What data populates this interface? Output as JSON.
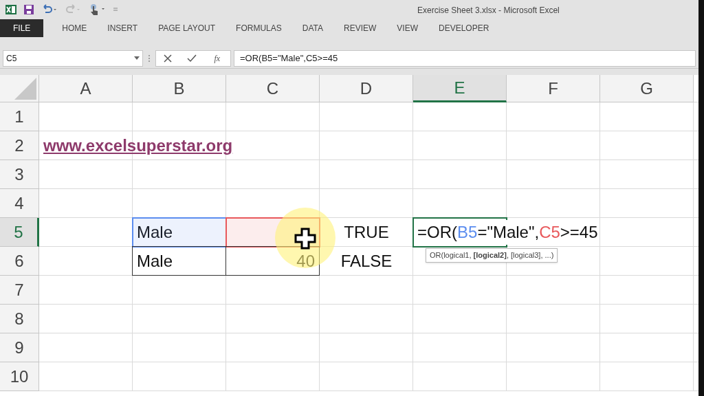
{
  "window": {
    "title": "Exercise Sheet 3.xlsx - Microsoft Excel"
  },
  "ribbon_tabs": [
    {
      "label": "FILE",
      "selected": true
    },
    {
      "label": "HOME",
      "selected": false
    },
    {
      "label": "INSERT",
      "selected": false
    },
    {
      "label": "PAGE LAYOUT",
      "selected": false
    },
    {
      "label": "FORMULAS",
      "selected": false
    },
    {
      "label": "DATA",
      "selected": false
    },
    {
      "label": "REVIEW",
      "selected": false
    },
    {
      "label": "VIEW",
      "selected": false
    },
    {
      "label": "DEVELOPER",
      "selected": false
    }
  ],
  "formula_bar": {
    "name_box": "C5",
    "function_button": "fx",
    "formula": "=OR(B5=\"Male\",C5>=45"
  },
  "columns": [
    {
      "label": "A",
      "selected": false
    },
    {
      "label": "B",
      "selected": false
    },
    {
      "label": "C",
      "selected": false
    },
    {
      "label": "D",
      "selected": false
    },
    {
      "label": "E",
      "selected": true
    },
    {
      "label": "F",
      "selected": false
    },
    {
      "label": "G",
      "selected": false
    }
  ],
  "rows": [
    {
      "header": "1",
      "selected": false,
      "cells": [
        null,
        null,
        null,
        null,
        null,
        null,
        null
      ]
    },
    {
      "header": "2",
      "selected": false,
      "cells": [
        {
          "kind": "link",
          "text": "www.excelsuperstar.org"
        },
        null,
        null,
        null,
        null,
        null,
        null
      ]
    },
    {
      "header": "3",
      "selected": false,
      "cells": [
        null,
        null,
        null,
        null,
        null,
        null,
        null
      ]
    },
    {
      "header": "4",
      "selected": false,
      "cells": [
        null,
        null,
        null,
        null,
        null,
        null,
        null
      ]
    },
    {
      "header": "5",
      "selected": true,
      "cells": [
        null,
        {
          "kind": "text",
          "text": "Male",
          "color": "#5b8def"
        },
        {
          "kind": "empty",
          "color": "#e8585b"
        },
        {
          "kind": "bool",
          "text": "TRUE"
        },
        {
          "kind": "formula",
          "selected": true,
          "parts": [
            {
              "text": "=OR("
            },
            {
              "text": "B5",
              "color": "#5b8def"
            },
            {
              "text": "=\"Male\","
            },
            {
              "text": "C5",
              "color": "#e8585b"
            },
            {
              "text": ">=45"
            }
          ],
          "tooltip": "OR(logical1, **[logical2]**, [logical3], ...)"
        },
        null,
        null
      ]
    },
    {
      "header": "6",
      "selected": false,
      "cells": [
        null,
        {
          "kind": "text",
          "text": "Male",
          "bordered": true
        },
        {
          "kind": "number",
          "text": "40",
          "bordered": true
        },
        {
          "kind": "bool",
          "text": "FALSE"
        },
        null,
        null,
        null
      ]
    },
    {
      "header": "7",
      "selected": false,
      "cells": [
        null,
        null,
        null,
        null,
        null,
        null,
        null
      ]
    },
    {
      "header": "8",
      "selected": false,
      "cells": [
        null,
        null,
        null,
        null,
        null,
        null,
        null
      ]
    },
    {
      "header": "9",
      "selected": false,
      "cells": [
        null,
        null,
        null,
        null,
        null,
        null,
        null
      ]
    },
    {
      "header": "10",
      "selected": false,
      "cells": [
        null,
        null,
        null,
        null,
        null,
        null,
        null
      ]
    }
  ]
}
